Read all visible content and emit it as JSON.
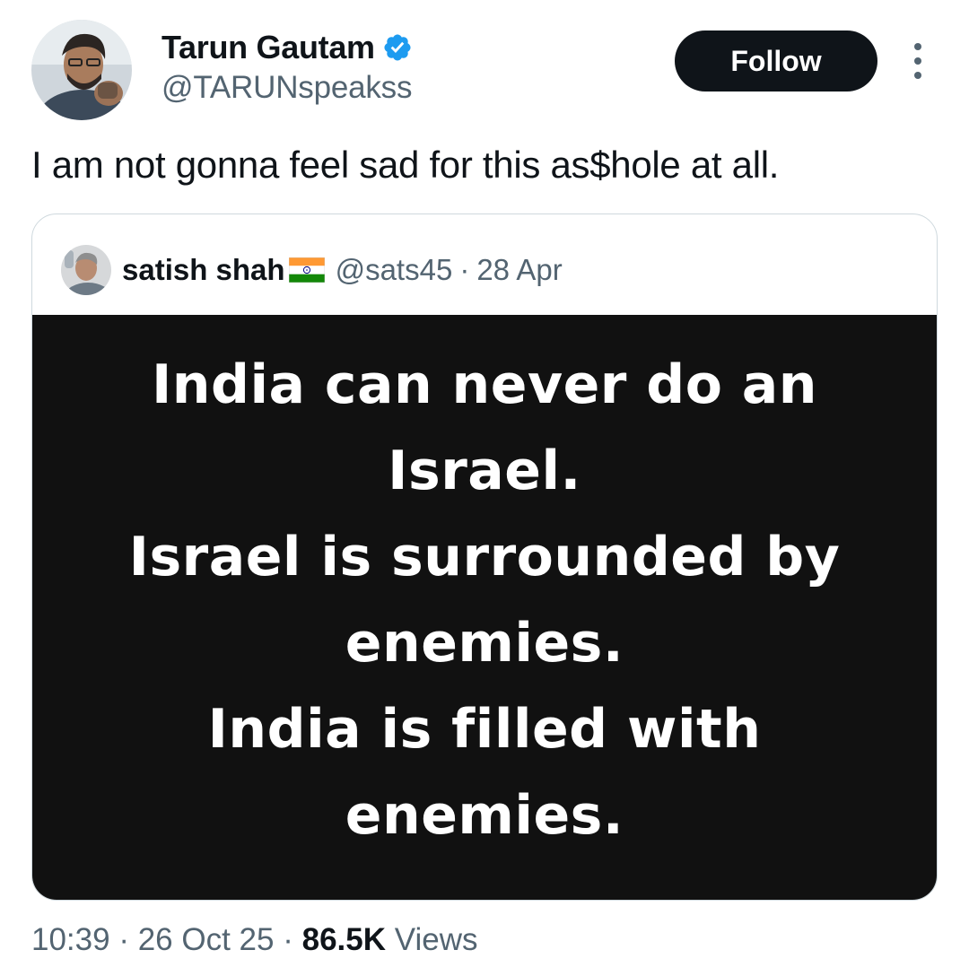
{
  "author": {
    "display_name": "Tarun Gautam",
    "handle": "@TARUNspeakss",
    "verified": true,
    "verified_icon": "verified-badge-icon",
    "avatar_icon": "profile-photo"
  },
  "follow_label": "Follow",
  "more_icon": "more-options-icon",
  "tweet_text": "I am not gonna feel sad for this as$hole at all.",
  "quote": {
    "display_name": "satish shah",
    "flag_icon": "india-flag-icon",
    "handle": "@sats45",
    "separator": "·",
    "date": "28 Apr",
    "media_lines": [
      "India can never do an",
      "Israel.",
      "Israel is surrounded by",
      "enemies.",
      "India is filled with",
      "enemies."
    ]
  },
  "meta": {
    "time": "10:39",
    "sep1": "·",
    "date": "26 Oct 25",
    "sep2": "·",
    "views_count": "86.5K",
    "views_label": "Views"
  },
  "colors": {
    "text_primary": "#0f1419",
    "text_secondary": "#536471",
    "verified_blue": "#1d9bf0",
    "border": "#cfd9de",
    "media_bg": "#111111"
  }
}
